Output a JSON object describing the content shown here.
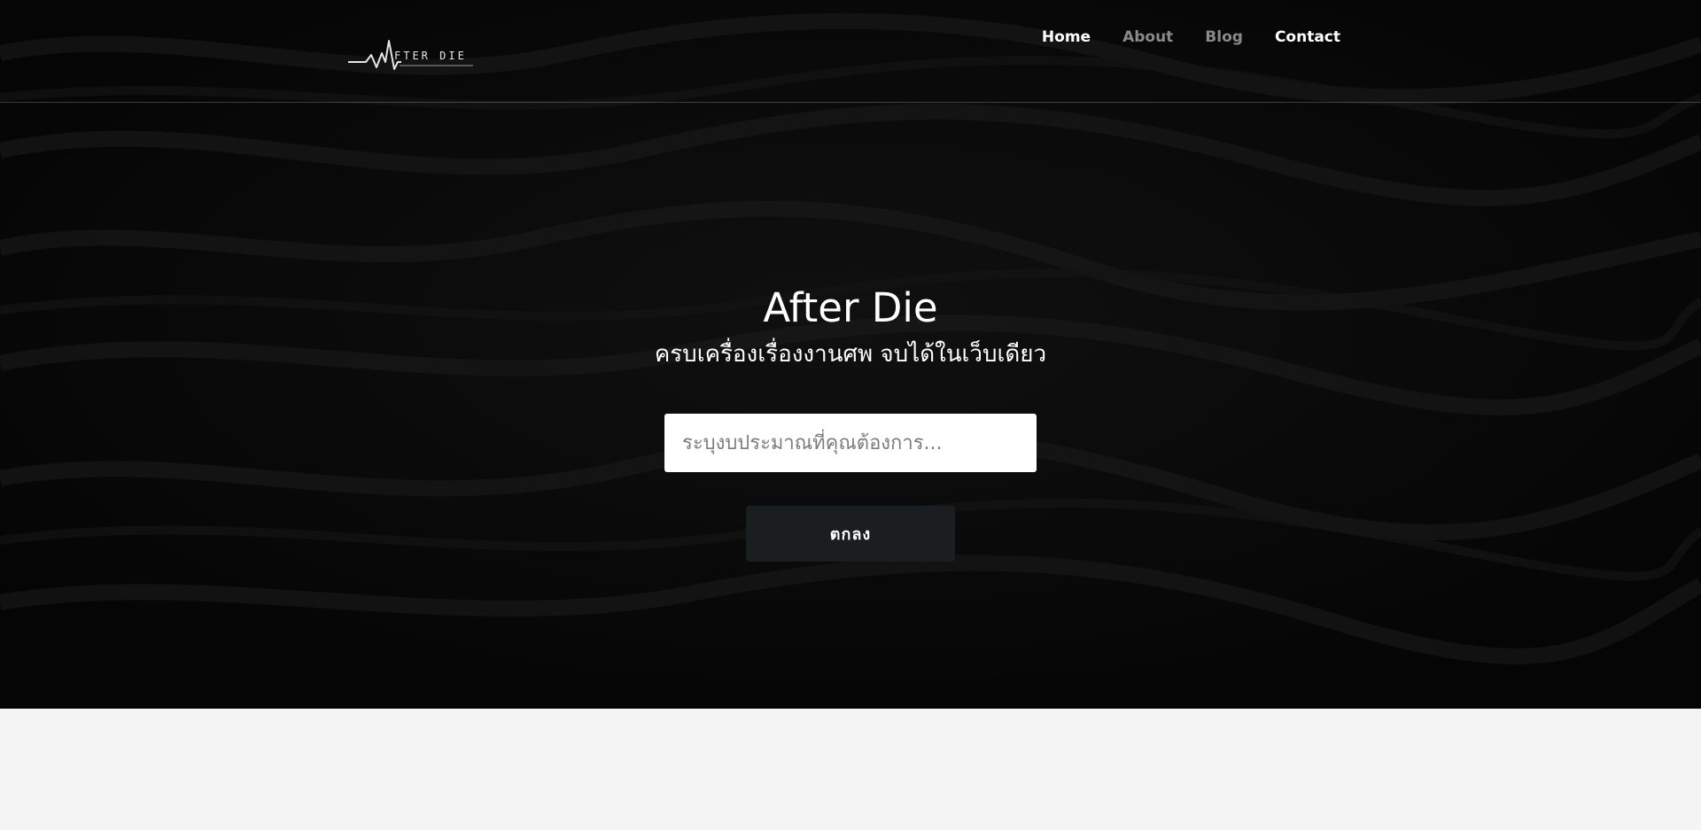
{
  "logo": {
    "text": "FTER DIE",
    "icon": "heartbeat-pulse-icon"
  },
  "nav": {
    "items": [
      {
        "label": "Home",
        "state": "active"
      },
      {
        "label": "About",
        "state": "muted"
      },
      {
        "label": "Blog",
        "state": "muted"
      },
      {
        "label": "Contact",
        "state": "normal"
      }
    ]
  },
  "hero": {
    "title": "After Die",
    "subtitle": "ครบเครื่องเรื่องงานศพ จบได้ในเว็บเดียว",
    "search_placeholder": "ระบุงบประมาณที่คุณต้องการ...",
    "search_value": "",
    "submit_label": "ตกลง"
  },
  "colors": {
    "hero_background": "#060606",
    "button_background": "#1a1e21",
    "nav_muted": "#8a8a8a",
    "page_background": "#f4f4f4"
  }
}
